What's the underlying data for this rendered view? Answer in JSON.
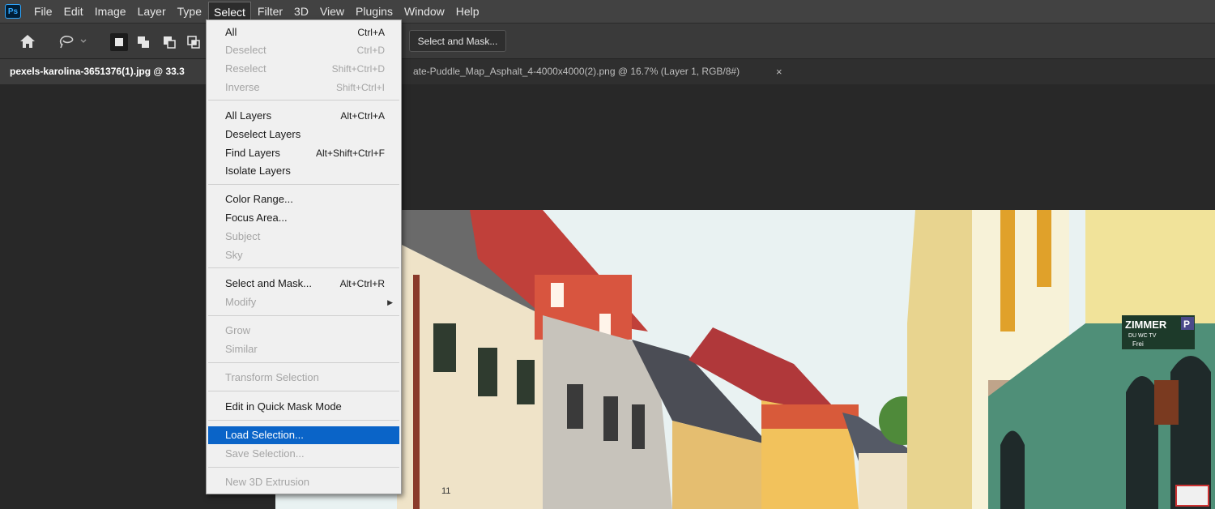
{
  "app": {
    "logo_text": "Ps",
    "menus": [
      "File",
      "Edit",
      "Image",
      "Layer",
      "Type",
      "Select",
      "Filter",
      "3D",
      "View",
      "Plugins",
      "Window",
      "Help"
    ],
    "active_menu": "Select"
  },
  "options_bar": {
    "select_and_mask_label": "Select and Mask..."
  },
  "tabs": {
    "active_label": "pexels-karolina-3651376(1).jpg @ 33.3",
    "inactive_label": "ate-Puddle_Map_Asphalt_4-4000x4000(2).png @ 16.7% (Layer 1, RGB/8#)",
    "close_glyph": "×"
  },
  "select_menu": {
    "items": [
      {
        "label": "All",
        "shortcut": "Ctrl+A",
        "enabled": true
      },
      {
        "label": "Deselect",
        "shortcut": "Ctrl+D",
        "enabled": false
      },
      {
        "label": "Reselect",
        "shortcut": "Shift+Ctrl+D",
        "enabled": false
      },
      {
        "label": "Inverse",
        "shortcut": "Shift+Ctrl+I",
        "enabled": false
      },
      {
        "label": "All Layers",
        "shortcut": "Alt+Ctrl+A",
        "enabled": true
      },
      {
        "label": "Deselect Layers",
        "shortcut": "",
        "enabled": true
      },
      {
        "label": "Find Layers",
        "shortcut": "Alt+Shift+Ctrl+F",
        "enabled": true
      },
      {
        "label": "Isolate Layers",
        "shortcut": "",
        "enabled": true
      },
      {
        "label": "Color Range...",
        "shortcut": "",
        "enabled": true
      },
      {
        "label": "Focus Area...",
        "shortcut": "",
        "enabled": true
      },
      {
        "label": "Subject",
        "shortcut": "",
        "enabled": false
      },
      {
        "label": "Sky",
        "shortcut": "",
        "enabled": false
      },
      {
        "label": "Select and Mask...",
        "shortcut": "Alt+Ctrl+R",
        "enabled": true
      },
      {
        "label": "Modify",
        "shortcut": "",
        "enabled": false,
        "submenu": true
      },
      {
        "label": "Grow",
        "shortcut": "",
        "enabled": false
      },
      {
        "label": "Similar",
        "shortcut": "",
        "enabled": false
      },
      {
        "label": "Transform Selection",
        "shortcut": "",
        "enabled": false
      },
      {
        "label": "Edit in Quick Mask Mode",
        "shortcut": "",
        "enabled": true
      },
      {
        "label": "Load Selection...",
        "shortcut": "",
        "enabled": true,
        "highlighted": true
      },
      {
        "label": "Save Selection...",
        "shortcut": "",
        "enabled": false
      },
      {
        "label": "New 3D Extrusion",
        "shortcut": "",
        "enabled": false
      }
    ]
  },
  "canvas_signage": {
    "sign_title": "ZIMMER",
    "sign_badge": "P",
    "sign_sub": "DU WC TV",
    "sign_free": "Frei",
    "house_number": "11"
  },
  "colors": {
    "accent_highlight": "#0a64c8",
    "menubar_bg": "#424242",
    "workspace_bg": "#282828"
  }
}
